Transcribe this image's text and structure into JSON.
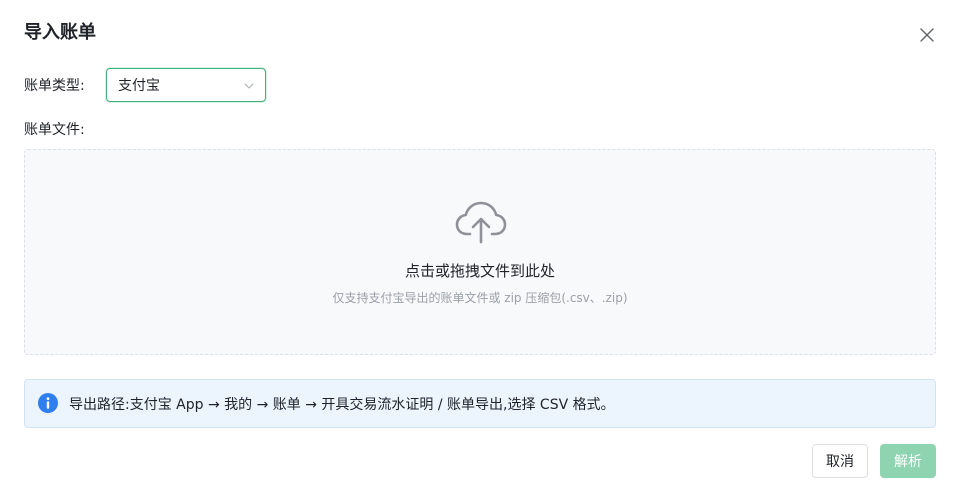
{
  "dialog": {
    "title": "导入账单",
    "close_icon": "close-icon"
  },
  "form": {
    "type_label": "账单类型:",
    "type_value": "支付宝",
    "file_label": "账单文件:"
  },
  "dropzone": {
    "icon": "upload-cloud-icon",
    "main_text": "点击或拖拽文件到此处",
    "hint_text": "仅支持支付宝导出的账单文件或 zip 压缩包(.csv、.zip)"
  },
  "tip": {
    "icon": "info-icon",
    "text": "导出路径:支付宝 App → 我的 → 账单 → 开具交易流水证明 / 账单导出,选择 CSV 格式。"
  },
  "buttons": {
    "cancel": "取消",
    "parse": "解析"
  },
  "colors": {
    "accent": "#3fb37a",
    "primary_disabled": "#8fd4b0",
    "info": "#2f7ff0"
  }
}
